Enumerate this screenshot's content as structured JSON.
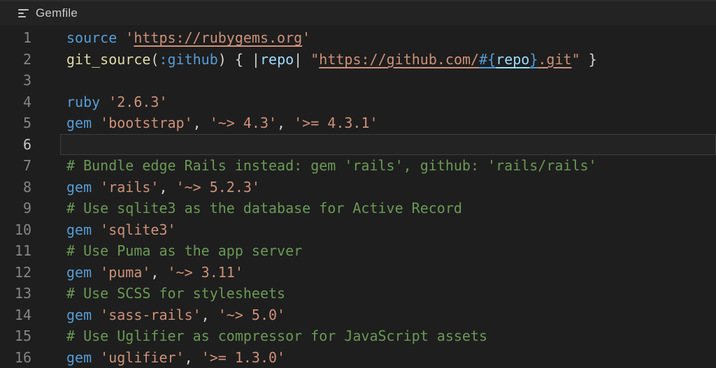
{
  "header": {
    "title": "Gemfile",
    "icon": "file-lines-icon"
  },
  "colors": {
    "background": "#1e1e1e",
    "header_background": "#232323",
    "title_text": "#cccccc",
    "line_number": "#858585",
    "active_line_number": "#c6c6c6",
    "active_line_border": "#3e3e42",
    "keyword": "#569cd6",
    "function": "#dcdcaa",
    "symbol": "#569cd6",
    "variable": "#9cdcfe",
    "string": "#ce9178",
    "comment": "#6a9955",
    "punctuation": "#d4d4d4"
  },
  "editor": {
    "language": "ruby",
    "active_line": 6,
    "lines": [
      {
        "num": 1,
        "segments": [
          {
            "t": "source",
            "c": "kw"
          },
          {
            "t": " ",
            "c": "plain"
          },
          {
            "t": "'",
            "c": "str"
          },
          {
            "t": "https://rubygems.org",
            "c": "link"
          },
          {
            "t": "'",
            "c": "str"
          }
        ]
      },
      {
        "num": 2,
        "segments": [
          {
            "t": "git_source",
            "c": "fn"
          },
          {
            "t": "(",
            "c": "punc"
          },
          {
            "t": ":github",
            "c": "sym"
          },
          {
            "t": ") { |",
            "c": "punc"
          },
          {
            "t": "repo",
            "c": "var"
          },
          {
            "t": "| ",
            "c": "punc"
          },
          {
            "t": "\"",
            "c": "str"
          },
          {
            "t": "https://github.com/",
            "c": "link"
          },
          {
            "t": "#{",
            "c": "interp"
          },
          {
            "t": "repo",
            "c": "varlink"
          },
          {
            "t": "}",
            "c": "interp"
          },
          {
            "t": ".git",
            "c": "link"
          },
          {
            "t": "\"",
            "c": "str"
          },
          {
            "t": " }",
            "c": "punc"
          }
        ]
      },
      {
        "num": 3,
        "segments": []
      },
      {
        "num": 4,
        "segments": [
          {
            "t": "ruby",
            "c": "kw"
          },
          {
            "t": " ",
            "c": "plain"
          },
          {
            "t": "'2.6.3'",
            "c": "str"
          }
        ]
      },
      {
        "num": 5,
        "segments": [
          {
            "t": "gem",
            "c": "kw"
          },
          {
            "t": " ",
            "c": "plain"
          },
          {
            "t": "'bootstrap'",
            "c": "str"
          },
          {
            "t": ", ",
            "c": "punc"
          },
          {
            "t": "'~> 4.3'",
            "c": "str"
          },
          {
            "t": ", ",
            "c": "punc"
          },
          {
            "t": "'>= 4.3.1'",
            "c": "str"
          }
        ]
      },
      {
        "num": 6,
        "segments": []
      },
      {
        "num": 7,
        "segments": [
          {
            "t": "# Bundle edge Rails instead: gem 'rails', github: 'rails/rails'",
            "c": "com"
          }
        ]
      },
      {
        "num": 8,
        "segments": [
          {
            "t": "gem",
            "c": "kw"
          },
          {
            "t": " ",
            "c": "plain"
          },
          {
            "t": "'rails'",
            "c": "str"
          },
          {
            "t": ", ",
            "c": "punc"
          },
          {
            "t": "'~> 5.2.3'",
            "c": "str"
          }
        ]
      },
      {
        "num": 9,
        "segments": [
          {
            "t": "# Use sqlite3 as the database for Active Record",
            "c": "com"
          }
        ]
      },
      {
        "num": 10,
        "segments": [
          {
            "t": "gem",
            "c": "kw"
          },
          {
            "t": " ",
            "c": "plain"
          },
          {
            "t": "'sqlite3'",
            "c": "str"
          }
        ]
      },
      {
        "num": 11,
        "segments": [
          {
            "t": "# Use Puma as the app server",
            "c": "com"
          }
        ]
      },
      {
        "num": 12,
        "segments": [
          {
            "t": "gem",
            "c": "kw"
          },
          {
            "t": " ",
            "c": "plain"
          },
          {
            "t": "'puma'",
            "c": "str"
          },
          {
            "t": ", ",
            "c": "punc"
          },
          {
            "t": "'~> 3.11'",
            "c": "str"
          }
        ]
      },
      {
        "num": 13,
        "segments": [
          {
            "t": "# Use SCSS for stylesheets",
            "c": "com"
          }
        ]
      },
      {
        "num": 14,
        "segments": [
          {
            "t": "gem",
            "c": "kw"
          },
          {
            "t": " ",
            "c": "plain"
          },
          {
            "t": "'sass-rails'",
            "c": "str"
          },
          {
            "t": ", ",
            "c": "punc"
          },
          {
            "t": "'~> 5.0'",
            "c": "str"
          }
        ]
      },
      {
        "num": 15,
        "segments": [
          {
            "t": "# Use Uglifier as compressor for JavaScript assets",
            "c": "com"
          }
        ]
      },
      {
        "num": 16,
        "segments": [
          {
            "t": "gem",
            "c": "kw"
          },
          {
            "t": " ",
            "c": "plain"
          },
          {
            "t": "'uglifier'",
            "c": "str"
          },
          {
            "t": ", ",
            "c": "punc"
          },
          {
            "t": "'>= 1.3.0'",
            "c": "str"
          }
        ]
      }
    ]
  }
}
